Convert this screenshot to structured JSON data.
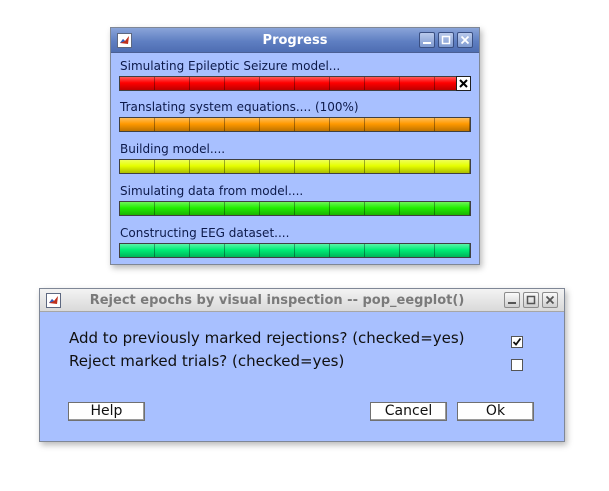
{
  "progress_window": {
    "title": "Progress",
    "tasks": [
      {
        "label": "Simulating Epileptic Seizure model...",
        "progress": 1.0,
        "color": "#ff0000",
        "cancel_icon": "close-x-icon"
      },
      {
        "label": "Translating system equations.... (100%)",
        "progress": 1.0,
        "color": "#ff9900"
      },
      {
        "label": "Building model....",
        "progress": 1.0,
        "color": "#e6ff00"
      },
      {
        "label": "Simulating data from model....",
        "progress": 1.0,
        "color": "#22ee00"
      },
      {
        "label": "Constructing EEG dataset....",
        "progress": 1.0,
        "color": "#00ee77"
      }
    ]
  },
  "reject_dialog": {
    "title": "Reject epochs by visual inspection -- pop_eegplot()",
    "options": [
      {
        "label": "Add to previously marked rejections? (checked=yes)",
        "checked": true
      },
      {
        "label": "Reject marked trials? (checked=yes)",
        "checked": false
      }
    ],
    "buttons": {
      "help": "Help",
      "cancel": "Cancel",
      "ok": "Ok"
    }
  },
  "colors": {
    "window_bg": "#a8c0ff",
    "progress_titlebar": "#6a89c9",
    "dialog_titlebar": "#e4e4e4"
  }
}
